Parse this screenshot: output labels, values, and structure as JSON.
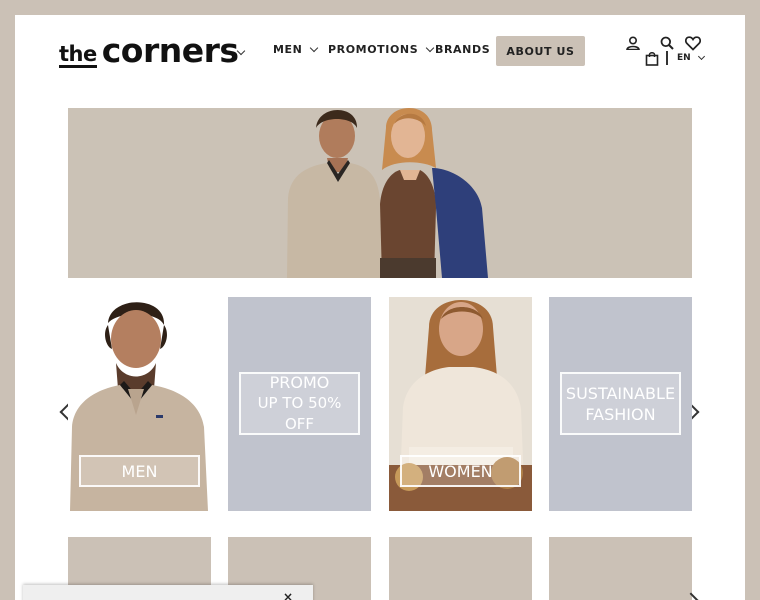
{
  "logo": {
    "the": "the",
    "corners": "corners"
  },
  "nav": {
    "men": "MEN",
    "promotions": "PROMOTIONS",
    "brands": "BRANDS",
    "about_us": "ABOUT US"
  },
  "language": {
    "selected": "EN"
  },
  "icons": [
    "user-icon",
    "search-icon",
    "heart-icon",
    "shopping-bag-icon",
    "chevron-down-icon",
    "chevron-left-icon",
    "chevron-right-icon",
    "close-icon"
  ],
  "carousel": {
    "tiles": [
      {
        "label": "MEN"
      },
      {
        "label_line1": "PROMO",
        "label_line2": "UP TO 50% OFF"
      },
      {
        "label": "WOMEN"
      },
      {
        "label_line1": "SUSTAINABLE",
        "label_line2": "FASHION"
      }
    ]
  },
  "colors": {
    "brand_beige": "#cbc1b6",
    "tile_blue_gray": "#c0c3cd",
    "text_dark": "#222222"
  }
}
